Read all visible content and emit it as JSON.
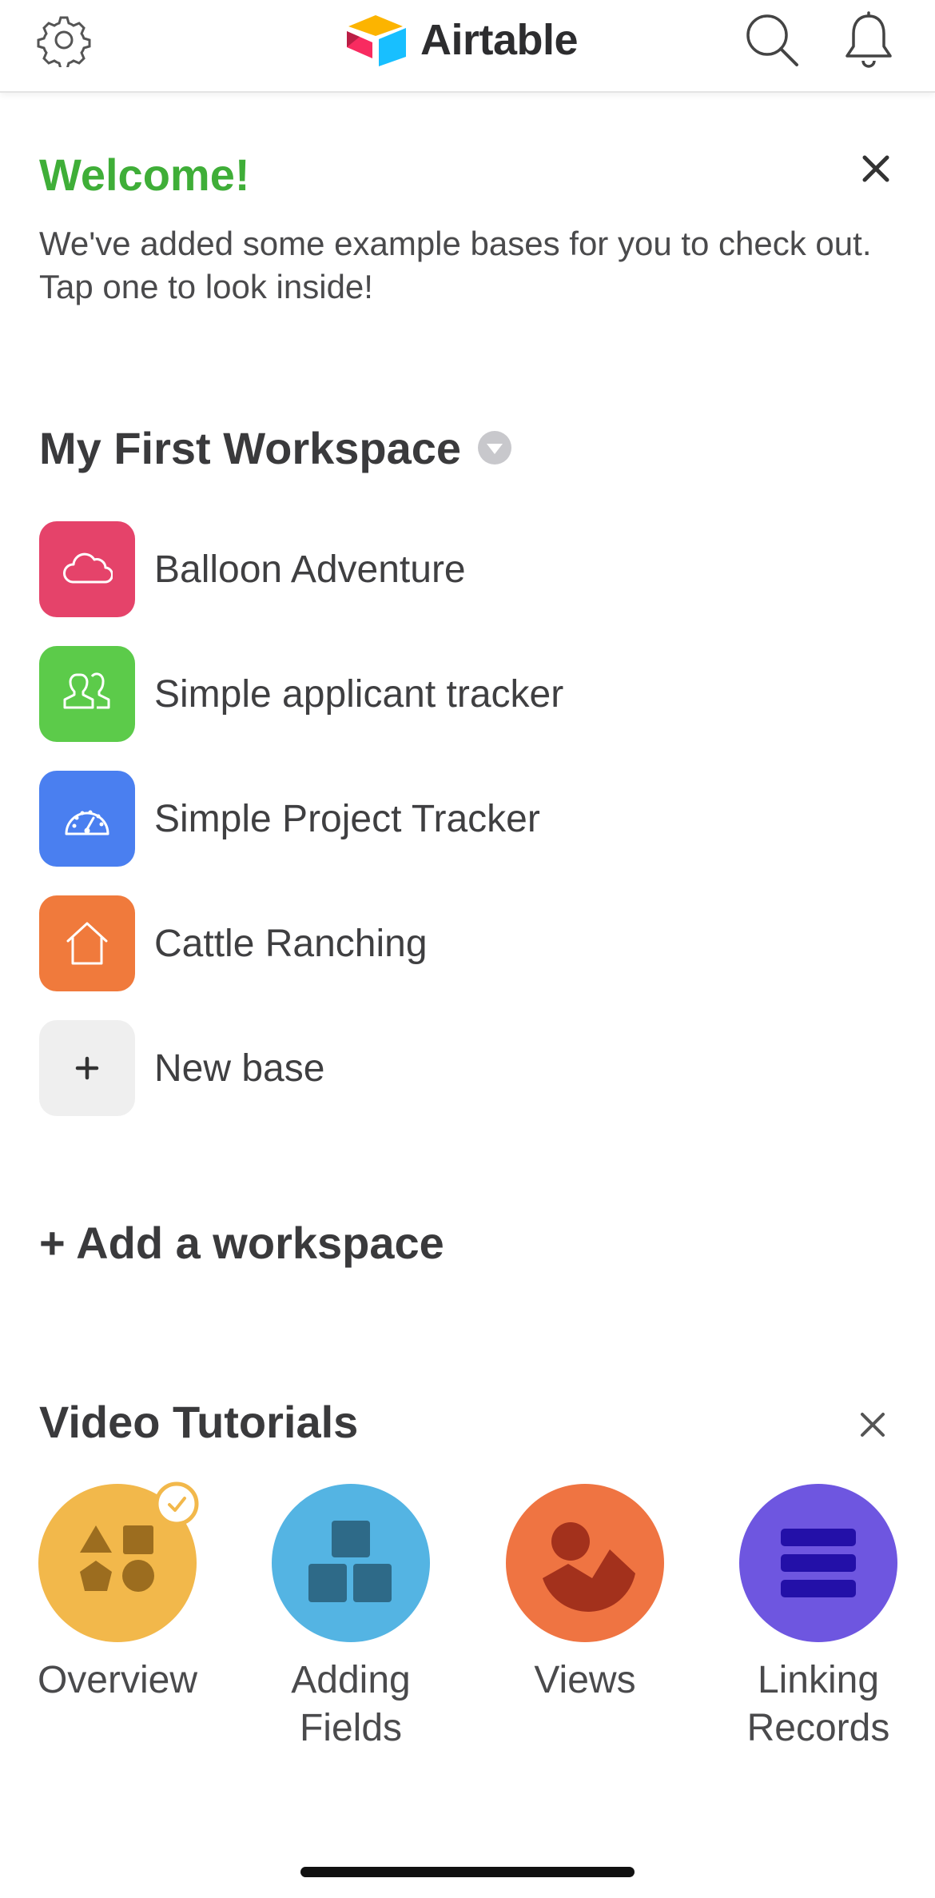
{
  "header": {
    "brand": "Airtable",
    "icons": [
      "gear-icon",
      "search-icon",
      "bell-icon"
    ]
  },
  "welcome": {
    "title": "Welcome!",
    "body": "We've added some example bases for you to check out. Tap one to look inside!"
  },
  "workspace": {
    "title": "My First Workspace",
    "bases": [
      {
        "name": "Balloon Adventure",
        "icon": "cloud-icon",
        "color": "#e5436a"
      },
      {
        "name": "Simple applicant tracker",
        "icon": "people-icon",
        "color": "#5ccb4a"
      },
      {
        "name": "Simple Project Tracker",
        "icon": "gauge-icon",
        "color": "#4a7ff0"
      },
      {
        "name": "Cattle Ranching",
        "icon": "house-icon",
        "color": "#f07a3c"
      }
    ],
    "new_base_label": "New base"
  },
  "add_workspace_label": "+ Add a workspace",
  "tutorials": {
    "title": "Video Tutorials",
    "items": [
      {
        "label": "Overview",
        "color": "#f2b84b",
        "watched": true
      },
      {
        "label": "Adding Fields",
        "color": "#54b4e3"
      },
      {
        "label": "Views",
        "color": "#ef7442"
      },
      {
        "label": "Linking Records",
        "color": "#6e56e0"
      }
    ]
  },
  "colors": {
    "accent_green": "#3fae38",
    "text_dark": "#3a3a3c"
  }
}
